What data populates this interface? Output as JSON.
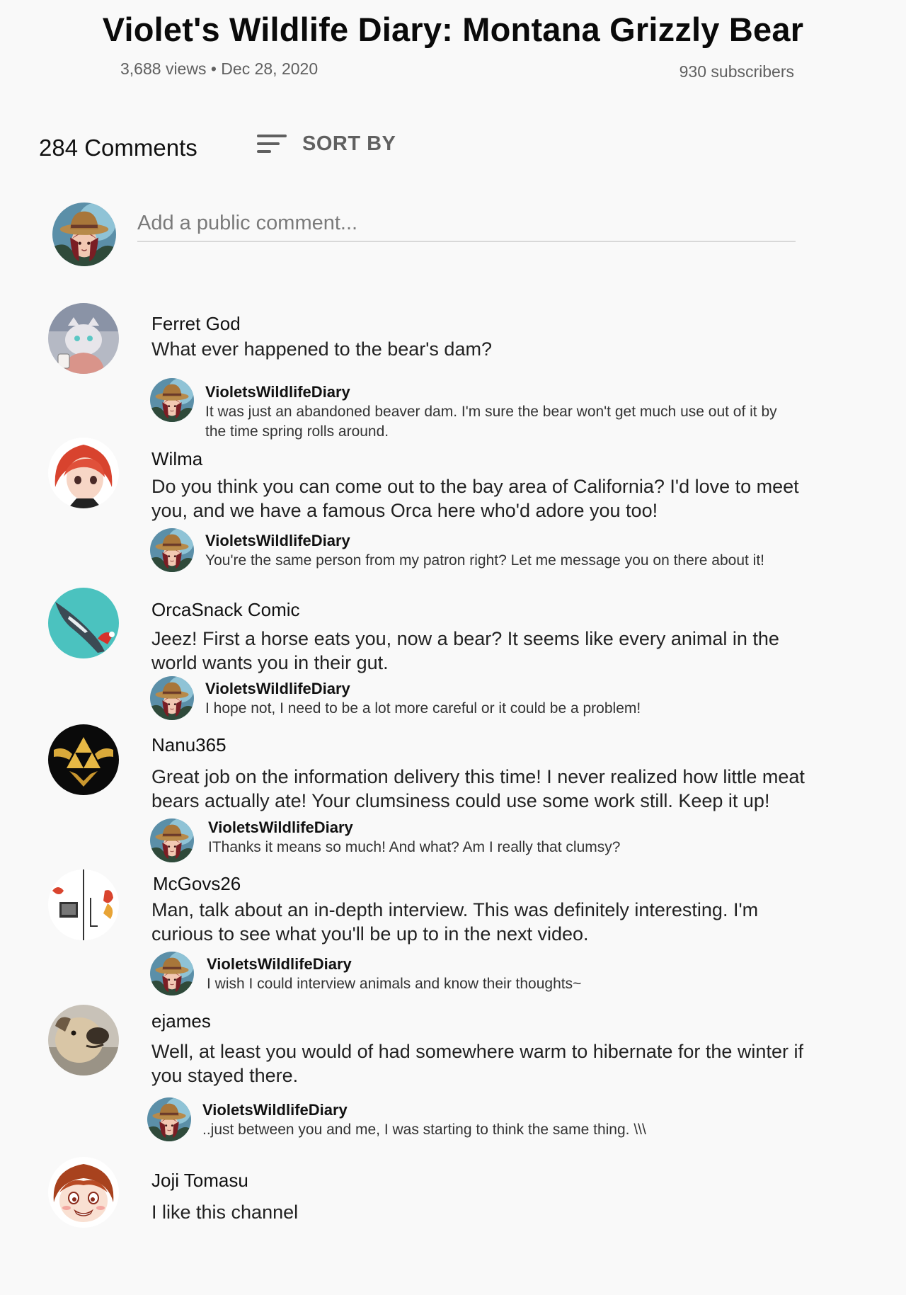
{
  "video": {
    "title": "Violet's Wildlife Diary: Montana Grizzly Bear",
    "views_date": "3,688 views • Dec 28, 2020",
    "subscribers": "930 subscribers"
  },
  "comments_header": {
    "count_label": "284 Comments",
    "sort_label": "SORT BY"
  },
  "compose": {
    "placeholder": "Add a public comment..."
  },
  "comments": [
    {
      "author": "Ferret God",
      "text": "What ever happened to the bear's dam?",
      "reply": {
        "author": "VioletsWildlifeDiary",
        "text": "It was just an abandoned beaver dam. I'm sure the bear won't get much use out of it by the time spring rolls around."
      }
    },
    {
      "author": "Wilma",
      "text": "Do  you think you can come out to the bay area of California? I'd love to meet you, and we have a famous Orca here who'd adore you too!",
      "reply": {
        "author": "VioletsWildlifeDiary",
        "text": "You're the same person from my patron right? Let me message you on there about it!"
      }
    },
    {
      "author": "OrcaSnack Comic",
      "text": "Jeez! First a horse eats you, now a bear? It seems like every animal in the world wants you in their gut.",
      "reply": {
        "author": "VioletsWildlifeDiary",
        "text": "I hope not,  I need to be a lot more careful or it could be a problem!"
      }
    },
    {
      "author": "Nanu365",
      "text": "Great job on the information delivery this time! I never realized how little meat bears actually ate! Your clumsiness could use some work still. Keep it up!",
      "reply": {
        "author": "VioletsWildlifeDiary",
        "text": "IThanks it means so much!  And what? Am I really that clumsy?"
      }
    },
    {
      "author": "McGovs26",
      "text": "Man, talk about an in-depth interview. This was definitely interesting. I'm curious to see what you'll be up to in the next video.",
      "reply": {
        "author": "VioletsWildlifeDiary",
        "text": "I wish I could interview animals and know their thoughts~"
      }
    },
    {
      "author": "ejames",
      "text": "Well, at least you would of had somewhere warm to hibernate for the winter if you stayed there.",
      "reply": {
        "author": "VioletsWildlifeDiary",
        "text": "..just between you and me, I was starting to think the same thing. \\\\\\"
      }
    },
    {
      "author": "Joji Tomasu",
      "text": "I like this channel"
    }
  ],
  "colors": {
    "background": "#f9f9f9",
    "secondary_text": "#606060",
    "divider": "#d8d8d8"
  },
  "icons": {
    "sort": "sort-lines-icon"
  }
}
